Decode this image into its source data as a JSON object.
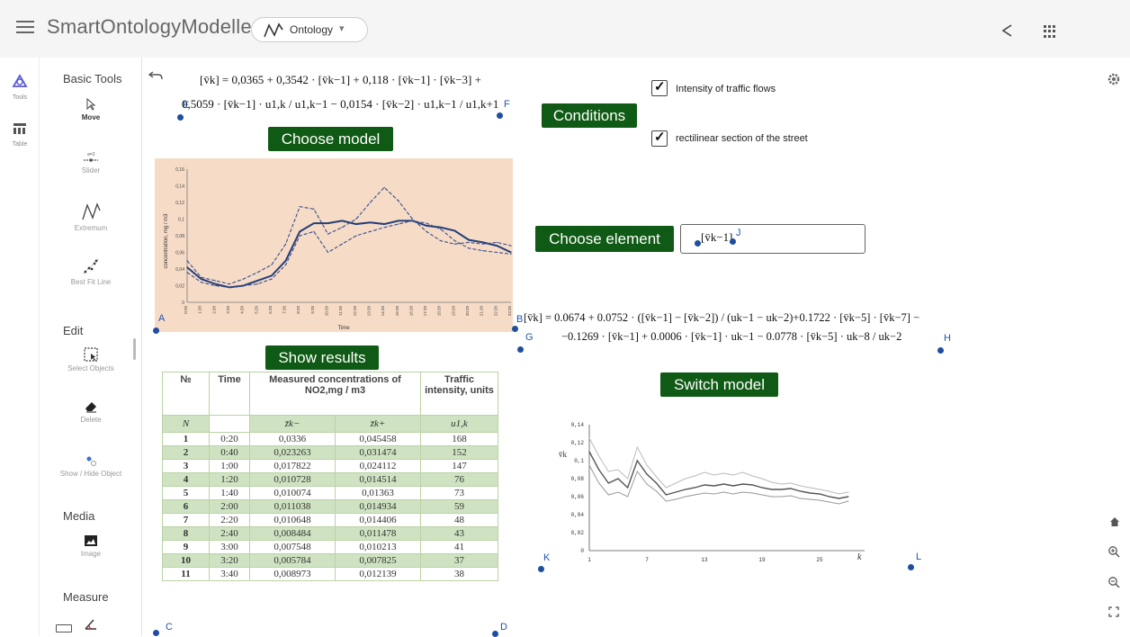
{
  "app": {
    "title": "SmartOntologyModeller",
    "perspective": "Ontology"
  },
  "rail": {
    "tools_label": "Tools",
    "table_label": "Table"
  },
  "tools": {
    "basic_title": "Basic Tools",
    "move": "Move",
    "slider": "Slider",
    "extremum": "Extremum",
    "bestfit": "Best Fit Line",
    "edit_title": "Edit",
    "select": "Select Objects",
    "delete": "Delete",
    "showhide": "Show / Hide Object",
    "media_title": "Media",
    "image": "Image",
    "measure_title": "Measure"
  },
  "canvas": {
    "formula1_line1": "[v̄k] = 0,0365 + 0,3542 · [v̄k−1] + 0,118 · [v̄k−1] · [v̄k−3] +",
    "formula1_line2": "0,5059 · [v̄k−1] · u1,k / u1,k−1 − 0,0154 · [v̄k−2] · u1,k−1 / u1,k+1",
    "formula2_line1": "[v̄k] = 0.0674 + 0.0752 · ([v̄k−1] − [v̄k−2]) / (uk−1 − uk−2)+0.1722 · [v̄k−5] · [v̄k−7] −",
    "formula2_line2": "−0.1269 · [v̄k−1] +  0.0006 · [v̄k−1] · uk−1 − 0.0778 · [v̄k−5] · uk−8 / uk−2",
    "input_value": "[v̄k−1]",
    "choose_model": "Choose model",
    "conditions": "Conditions",
    "choose_element": "Choose element",
    "show_results": "Show results",
    "switch_model": "Switch model",
    "cond1": "Intensity of traffic flows",
    "cond2": "rectilinear section of the street",
    "points": {
      "A": "A",
      "B": "B",
      "C": "C",
      "D": "D",
      "E": "E",
      "F": "F",
      "G": "G",
      "H": "H",
      "I": "I",
      "J": "J",
      "K": "K",
      "L": "L"
    }
  },
  "table": {
    "h_no": "№",
    "h_time": "Time",
    "h_measured": "Measured concentrations of NO2,mg / m3",
    "h_traffic": "Traffic intensity, units",
    "sub": [
      "N",
      "",
      "z̄k−",
      "z̄k+",
      "u1,k"
    ],
    "rows": [
      [
        "1",
        "0:20",
        "0,0336",
        "0,045458",
        "168"
      ],
      [
        "2",
        "0:40",
        "0,023263",
        "0,031474",
        "152"
      ],
      [
        "3",
        "1:00",
        "0,017822",
        "0,024112",
        "147"
      ],
      [
        "4",
        "1:20",
        "0,010728",
        "0,014514",
        "76"
      ],
      [
        "5",
        "1:40",
        "0,010074",
        "0,01363",
        "73"
      ],
      [
        "6",
        "2:00",
        "0,011038",
        "0,014934",
        "59"
      ],
      [
        "7",
        "2:20",
        "0,010648",
        "0,014406",
        "48"
      ],
      [
        "8",
        "2:40",
        "0,008484",
        "0,011478",
        "43"
      ],
      [
        "9",
        "3:00",
        "0,007548",
        "0,010213",
        "41"
      ],
      [
        "10",
        "3:20",
        "0,005784",
        "0,007825",
        "37"
      ],
      [
        "11",
        "3:40",
        "0,008973",
        "0,012139",
        "38"
      ]
    ]
  },
  "chart1": {
    "ylabel": "concentration, mg / m3",
    "xlabel": "Time",
    "yticks": [
      "0,16",
      "0,14",
      "0,12",
      "0,1",
      "0,08",
      "0,06",
      "0,04",
      "0,02",
      "0"
    ],
    "xticks": [
      "0:20",
      "1:20",
      "2:20",
      "3:20",
      "4:20",
      "5:20",
      "6:20",
      "7:20",
      "8:20",
      "9:20",
      "10:20",
      "11:20",
      "12:20",
      "13:20",
      "14:20",
      "15:20",
      "16:20",
      "17:20",
      "18:20",
      "19:20",
      "20:20",
      "21:20",
      "22:20",
      "23:20"
    ],
    "colors": {
      "line": "#243d7a",
      "dash": "#3a4e8a",
      "bg": "#f6dcc7"
    }
  },
  "chart2": {
    "ylabel": "v̄k",
    "yticks": [
      "0,14",
      "0,12",
      "0,1",
      "0,08",
      "0,06",
      "0,04",
      "0,02",
      "0"
    ],
    "xticks": [
      "1",
      "7",
      "13",
      "19",
      "25"
    ],
    "xlabel": "k"
  },
  "chart_data": [
    {
      "type": "line",
      "ylabel": "concentration, mg / m3",
      "xlabel": "Time",
      "ylim": [
        0,
        0.16
      ],
      "series": [
        {
          "values": [
            0.042,
            0.028,
            0.022,
            0.018,
            0.02,
            0.026,
            0.032,
            0.05,
            0.085,
            0.095,
            0.095,
            0.098,
            0.094,
            0.096,
            0.094,
            0.098,
            0.098,
            0.092,
            0.09,
            0.086,
            0.075,
            0.072,
            0.068,
            0.06
          ]
        },
        {
          "values": [
            0.05,
            0.03,
            0.026,
            0.022,
            0.028,
            0.036,
            0.045,
            0.07,
            0.115,
            0.112,
            0.082,
            0.09,
            0.1,
            0.12,
            0.138,
            0.122,
            0.1,
            0.085,
            0.074,
            0.07,
            0.072,
            0.07,
            0.072,
            0.068
          ]
        },
        {
          "values": [
            0.036,
            0.024,
            0.02,
            0.018,
            0.02,
            0.022,
            0.028,
            0.045,
            0.08,
            0.085,
            0.06,
            0.07,
            0.08,
            0.085,
            0.09,
            0.094,
            0.098,
            0.095,
            0.088,
            0.074,
            0.065,
            0.062,
            0.06,
            0.058
          ]
        }
      ]
    },
    {
      "type": "line",
      "ylabel": "v̄k",
      "xlabel": "k",
      "ylim": [
        0,
        0.14
      ],
      "series": [
        {
          "values": [
            0.11,
            0.09,
            0.075,
            0.08,
            0.07,
            0.1,
            0.085,
            0.075,
            0.062,
            0.065,
            0.068,
            0.07,
            0.073,
            0.072,
            0.074,
            0.072,
            0.074,
            0.073,
            0.07,
            0.068,
            0.068,
            0.069,
            0.066,
            0.064,
            0.063,
            0.06,
            0.058,
            0.06
          ]
        },
        {
          "values": [
            0.125,
            0.105,
            0.088,
            0.09,
            0.08,
            0.115,
            0.095,
            0.082,
            0.07,
            0.075,
            0.08,
            0.083,
            0.087,
            0.084,
            0.086,
            0.084,
            0.087,
            0.083,
            0.08,
            0.076,
            0.074,
            0.075,
            0.072,
            0.07,
            0.068,
            0.066,
            0.063,
            0.065
          ]
        },
        {
          "values": [
            0.095,
            0.075,
            0.062,
            0.065,
            0.06,
            0.088,
            0.074,
            0.066,
            0.055,
            0.057,
            0.06,
            0.062,
            0.064,
            0.063,
            0.065,
            0.063,
            0.065,
            0.064,
            0.062,
            0.06,
            0.06,
            0.061,
            0.058,
            0.057,
            0.056,
            0.054,
            0.052,
            0.055
          ]
        }
      ]
    }
  ]
}
